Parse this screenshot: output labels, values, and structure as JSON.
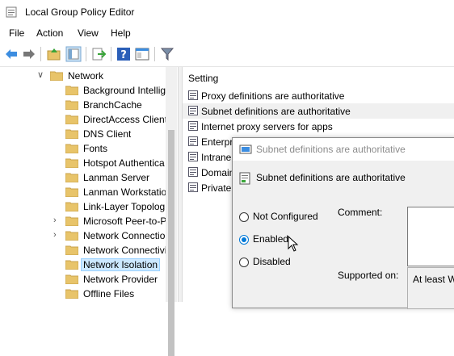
{
  "window": {
    "title": "Local Group Policy Editor",
    "app_icon": "gpedit-icon"
  },
  "menu": [
    "File",
    "Action",
    "View",
    "Help"
  ],
  "toolbar": {
    "buttons": [
      "back-icon",
      "forward-icon",
      "up-folder-icon",
      "show-hide-tree-icon",
      "export-list-icon",
      "help-icon",
      "properties-view-icon",
      "filter-icon"
    ]
  },
  "tree": {
    "parent": "Network",
    "items": [
      {
        "label": "Background Intellig",
        "expandable": false
      },
      {
        "label": "BranchCache",
        "expandable": false
      },
      {
        "label": "DirectAccess Client",
        "expandable": false
      },
      {
        "label": "DNS Client",
        "expandable": false
      },
      {
        "label": "Fonts",
        "expandable": false
      },
      {
        "label": "Hotspot Authentica",
        "expandable": false
      },
      {
        "label": "Lanman Server",
        "expandable": false
      },
      {
        "label": "Lanman Workstatio",
        "expandable": false
      },
      {
        "label": "Link-Layer Topolog",
        "expandable": false
      },
      {
        "label": "Microsoft Peer-to-P",
        "expandable": true
      },
      {
        "label": "Network Connectio",
        "expandable": true
      },
      {
        "label": "Network Connectivi",
        "expandable": false
      },
      {
        "label": "Network Isolation",
        "expandable": false,
        "selected": true
      },
      {
        "label": "Network Provider",
        "expandable": false
      },
      {
        "label": "Offline Files",
        "expandable": false
      }
    ]
  },
  "settings": {
    "column_header": "Setting",
    "rows": [
      {
        "label": "Proxy definitions are authoritative",
        "highlighted": false
      },
      {
        "label": "Subnet definitions are authoritative",
        "highlighted": true
      },
      {
        "label": "Internet proxy servers for apps",
        "highlighted": false
      },
      {
        "label": "Enterpr",
        "highlighted": false
      },
      {
        "label": "Intrane",
        "highlighted": false
      },
      {
        "label": "Domain",
        "highlighted": false
      },
      {
        "label": "Private",
        "highlighted": false
      }
    ]
  },
  "dialog": {
    "title": "Subnet definitions are authoritative",
    "heading": "Subnet definitions are authoritative",
    "options": [
      "Not Configured",
      "Enabled",
      "Disabled"
    ],
    "selected_option": "Enabled",
    "comment_label": "Comment:",
    "comment_value": "",
    "supported_label": "Supported on:",
    "supported_value": "At least W"
  },
  "colors": {
    "selection": "#cce8ff",
    "accent": "#0078d7",
    "folder": "#e8c46a"
  }
}
